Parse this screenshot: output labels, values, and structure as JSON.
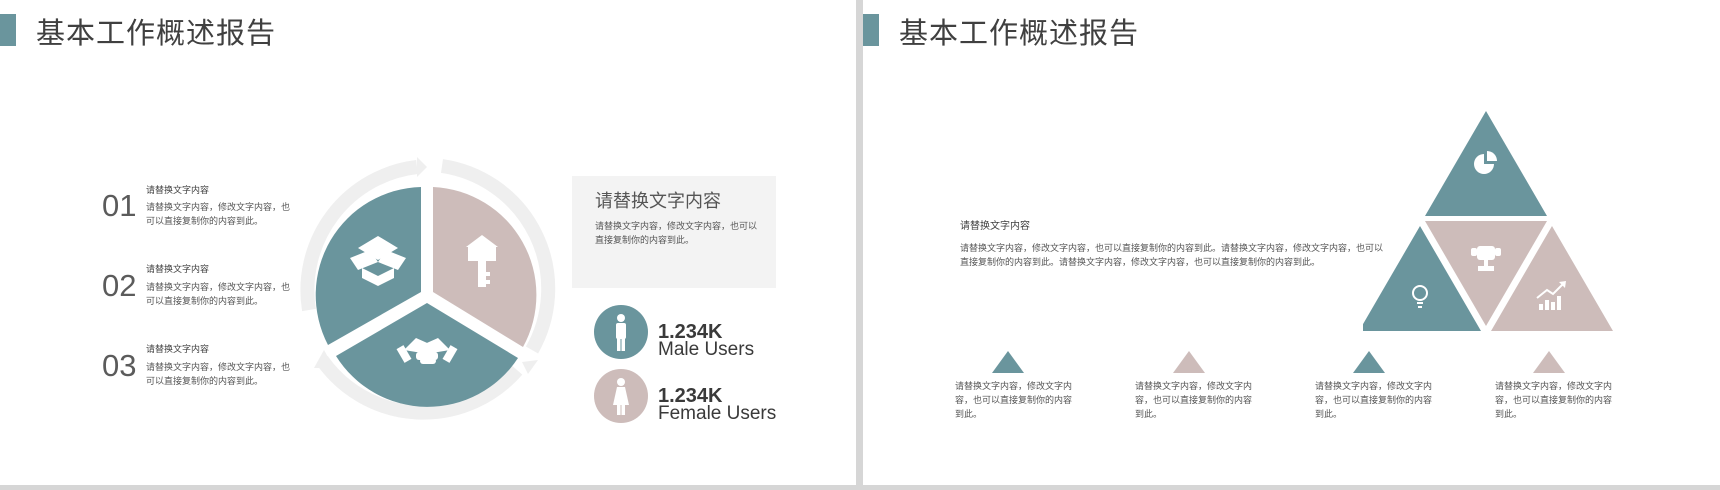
{
  "colors": {
    "teal": "#6a959d",
    "pink": "#cdbcba",
    "ring": "#efefef"
  },
  "slide1": {
    "title": "基本工作概述报告",
    "items": [
      {
        "num": "01",
        "heading": "请替换文字内容",
        "body": "请替换文字内容，修改文字内容，也可以直接复制你的内容到此。"
      },
      {
        "num": "02",
        "heading": "请替换文字内容",
        "body": "请替换文字内容，修改文字内容，也可以直接复制你的内容到此。"
      },
      {
        "num": "03",
        "heading": "请替换文字内容",
        "body": "请替换文字内容，修改文字内容，也可以直接复制你的内容到此。"
      }
    ],
    "cycle_icons": [
      "box-icon",
      "house-key-icon",
      "handshake-icon"
    ],
    "box": {
      "heading": "请替换文字内容",
      "body": "请替换文字内容，修改文字内容，也可以直接复制你的内容到此。"
    },
    "male": {
      "value": "1.234K",
      "label": "Male Users",
      "icon": "male-user-icon"
    },
    "female": {
      "value": "1.234K",
      "label": "Female Users",
      "icon": "female-user-icon"
    }
  },
  "slide2": {
    "title": "基本工作概述报告",
    "heading": "请替换文字内容",
    "body": "请替换文字内容，修改文字内容，也可以直接复制你的内容到此。请替换文字内容，修改文字内容，也可以直接复制你的内容到此。请替换文字内容，修改文字内容，也可以直接复制你的内容到此。",
    "triangle_icons": [
      "pie-chart-icon",
      "lightbulb-icon",
      "trophy-icon",
      "growth-chart-icon"
    ],
    "bottom_items": [
      "请替换文字内容，修改文字内容，也可以直接复制你的内容到此。",
      "请替换文字内容，修改文字内容，也可以直接复制你的内容到此。",
      "请替换文字内容，修改文字内容，也可以直接复制你的内容到此。",
      "请替换文字内容，修改文字内容，也可以直接复制你的内容到此。"
    ]
  }
}
